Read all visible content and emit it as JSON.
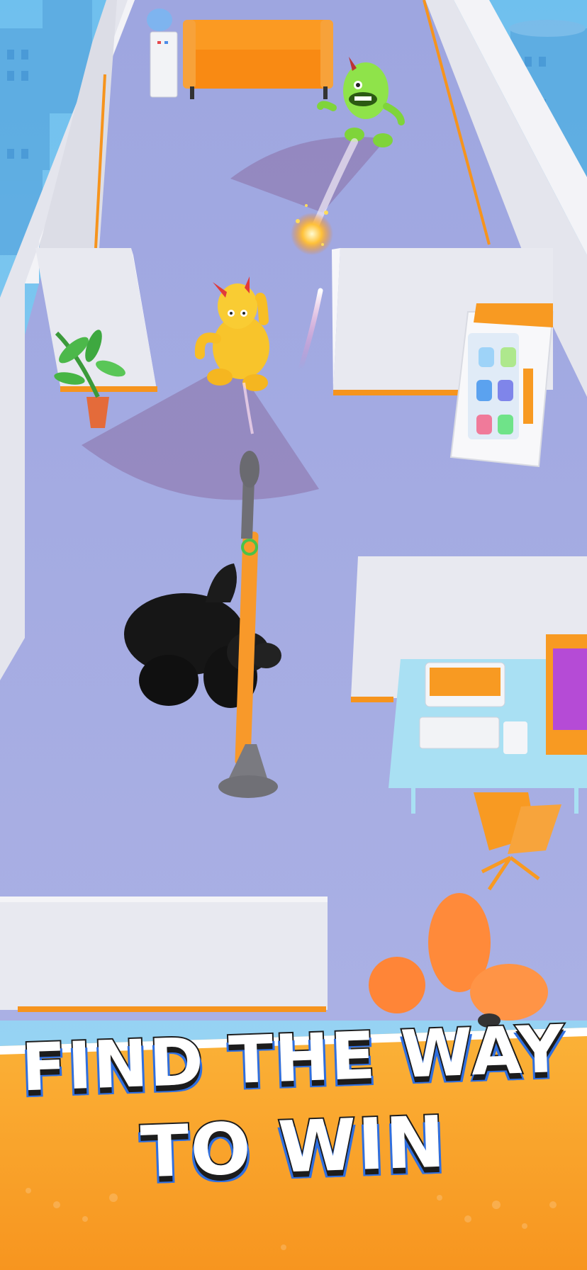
{
  "screen": {
    "kind": "game-promo-screenshot",
    "colors": {
      "sky": "#7ec8ef",
      "floor": "#a7addf",
      "wall": "#e6e7ee",
      "accent_orange": "#f6941d",
      "banner_orange": "#f8a22c",
      "text_outline": "#1c1c1c",
      "text_shadow_blue": "#2f6fe0",
      "vision_cone": "#8a6fa6"
    }
  },
  "headline": {
    "line1": "FIND THE WAY",
    "line2": "TO WIN"
  },
  "characters": {
    "player": "black-giant-with-rocket-launcher-icon",
    "enemy_yellow": "yellow-horned-monster-icon",
    "enemy_green": "green-horned-monster-icon",
    "defeated": "orange-defeated-monster-icon"
  },
  "props": [
    "water-cooler-icon",
    "orange-sofa-icon",
    "potted-plant-icon",
    "vending-machine-icon",
    "computer-desk-icon",
    "office-chair-icon"
  ],
  "effects": [
    "rocket-projectile-icon",
    "explosion-spark-icon",
    "vision-cone-icon"
  ]
}
